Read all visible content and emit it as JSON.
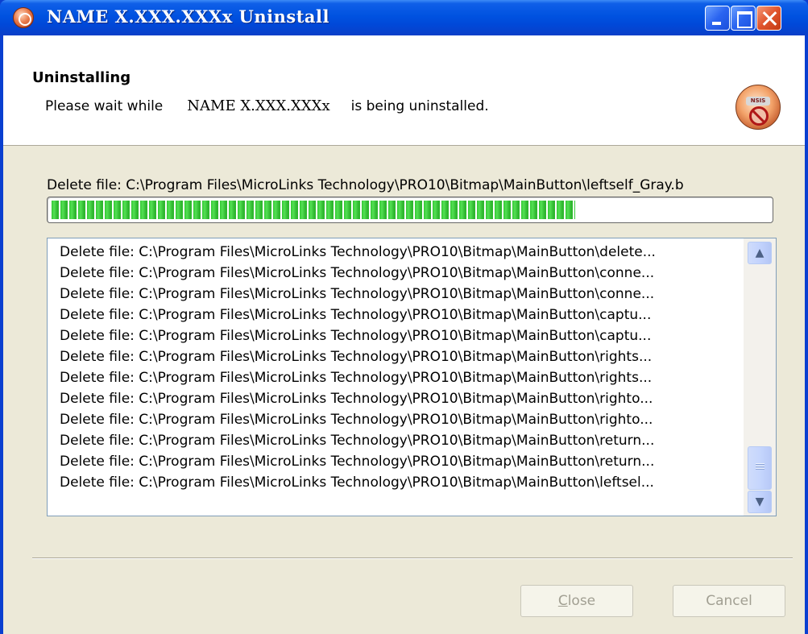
{
  "window": {
    "title": "NAME X.XXX.XXXx Uninstall",
    "icon": "uninstall-app-icon",
    "controls": [
      "minimize-icon",
      "maximize-icon",
      "close-icon"
    ]
  },
  "header": {
    "title": "Uninstalling",
    "subtitle_prefix": "Please wait while",
    "product_name": "NAME X.XXX.XXXx",
    "subtitle_suffix": "is being uninstalled.",
    "badge_text": "NSIS"
  },
  "status": {
    "current_action": "Delete file: C:\\Program Files\\MicroLinks Technology\\PRO10\\Bitmap\\MainButton\\leftself_Gray.b",
    "progress_fraction": 0.73
  },
  "log": {
    "items": [
      "Delete file: C:\\Program Files\\MicroLinks Technology\\PRO10\\Bitmap\\MainButton\\delete...",
      "Delete file: C:\\Program Files\\MicroLinks Technology\\PRO10\\Bitmap\\MainButton\\conne...",
      "Delete file: C:\\Program Files\\MicroLinks Technology\\PRO10\\Bitmap\\MainButton\\conne...",
      "Delete file: C:\\Program Files\\MicroLinks Technology\\PRO10\\Bitmap\\MainButton\\captu...",
      "Delete file: C:\\Program Files\\MicroLinks Technology\\PRO10\\Bitmap\\MainButton\\captu...",
      "Delete file: C:\\Program Files\\MicroLinks Technology\\PRO10\\Bitmap\\MainButton\\rights...",
      "Delete file: C:\\Program Files\\MicroLinks Technology\\PRO10\\Bitmap\\MainButton\\rights...",
      "Delete file: C:\\Program Files\\MicroLinks Technology\\PRO10\\Bitmap\\MainButton\\righto...",
      "Delete file: C:\\Program Files\\MicroLinks Technology\\PRO10\\Bitmap\\MainButton\\righto...",
      "Delete file: C:\\Program Files\\MicroLinks Technology\\PRO10\\Bitmap\\MainButton\\return...",
      "Delete file: C:\\Program Files\\MicroLinks Technology\\PRO10\\Bitmap\\MainButton\\return...",
      "Delete file: C:\\Program Files\\MicroLinks Technology\\PRO10\\Bitmap\\MainButton\\leftsel..."
    ]
  },
  "buttons": {
    "close_label_access": "C",
    "close_label_rest": "lose",
    "cancel_label": "Cancel"
  },
  "colors": {
    "title_bar": "#0054e3",
    "progress": "#33c733",
    "disabled_text": "#a19f92",
    "dialog_bg": "#ece9d8"
  }
}
